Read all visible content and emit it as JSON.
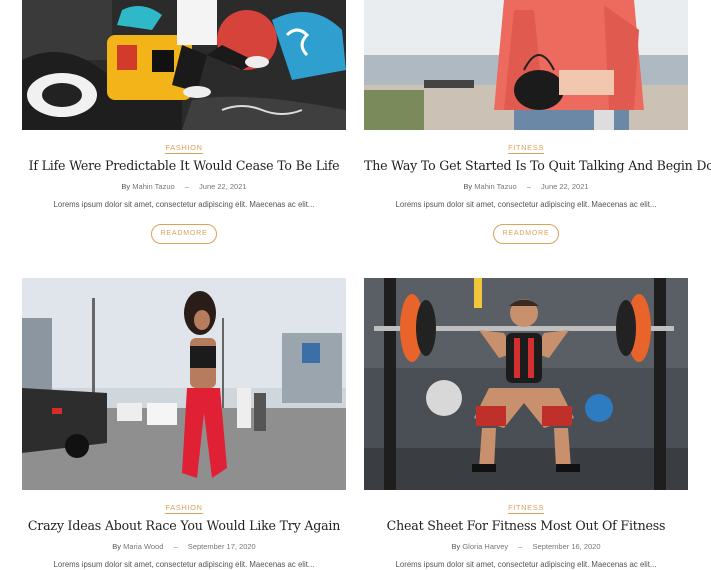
{
  "colors": {
    "accent": "#d9a35c",
    "title": "#222222"
  },
  "posts": [
    {
      "category": "Fashion",
      "title": "If Life Were Predictable It Would Cease To Be Life",
      "by": "By",
      "author": "Mahin Tazuo",
      "date": "June 22, 2021",
      "excerpt": "Lorems ipsum dolor sit amet, consectetur adipiscing elit. Maecenas ac elit...",
      "readmore": "Readmore"
    },
    {
      "category": "Fitness",
      "title": "The Way To Get Started Is To Quit Talking And Begin Doing",
      "by": "By",
      "author": "Mahin Tazuo",
      "date": "June 22, 2021",
      "excerpt": "Lorems ipsum dolor sit amet, consectetur adipiscing elit. Maecenas ac elit...",
      "readmore": "Readmore"
    },
    {
      "category": "Fashion",
      "title": "Crazy Ideas About Race You Would Like Try Again",
      "by": "By",
      "author": "Maria Wood",
      "date": "September 17, 2020",
      "excerpt": "Lorems ipsum dolor sit amet, consectetur adipiscing elit. Maecenas ac elit..."
    },
    {
      "category": "Fitness",
      "title": "Cheat Sheet For Fitness Most Out Of Fitness",
      "by": "By",
      "author": "Gloria Harvey",
      "date": "September 16, 2020",
      "excerpt": "Lorems ipsum dolor sit amet, consectetur adipiscing elit. Maecenas ac elit..."
    }
  ]
}
